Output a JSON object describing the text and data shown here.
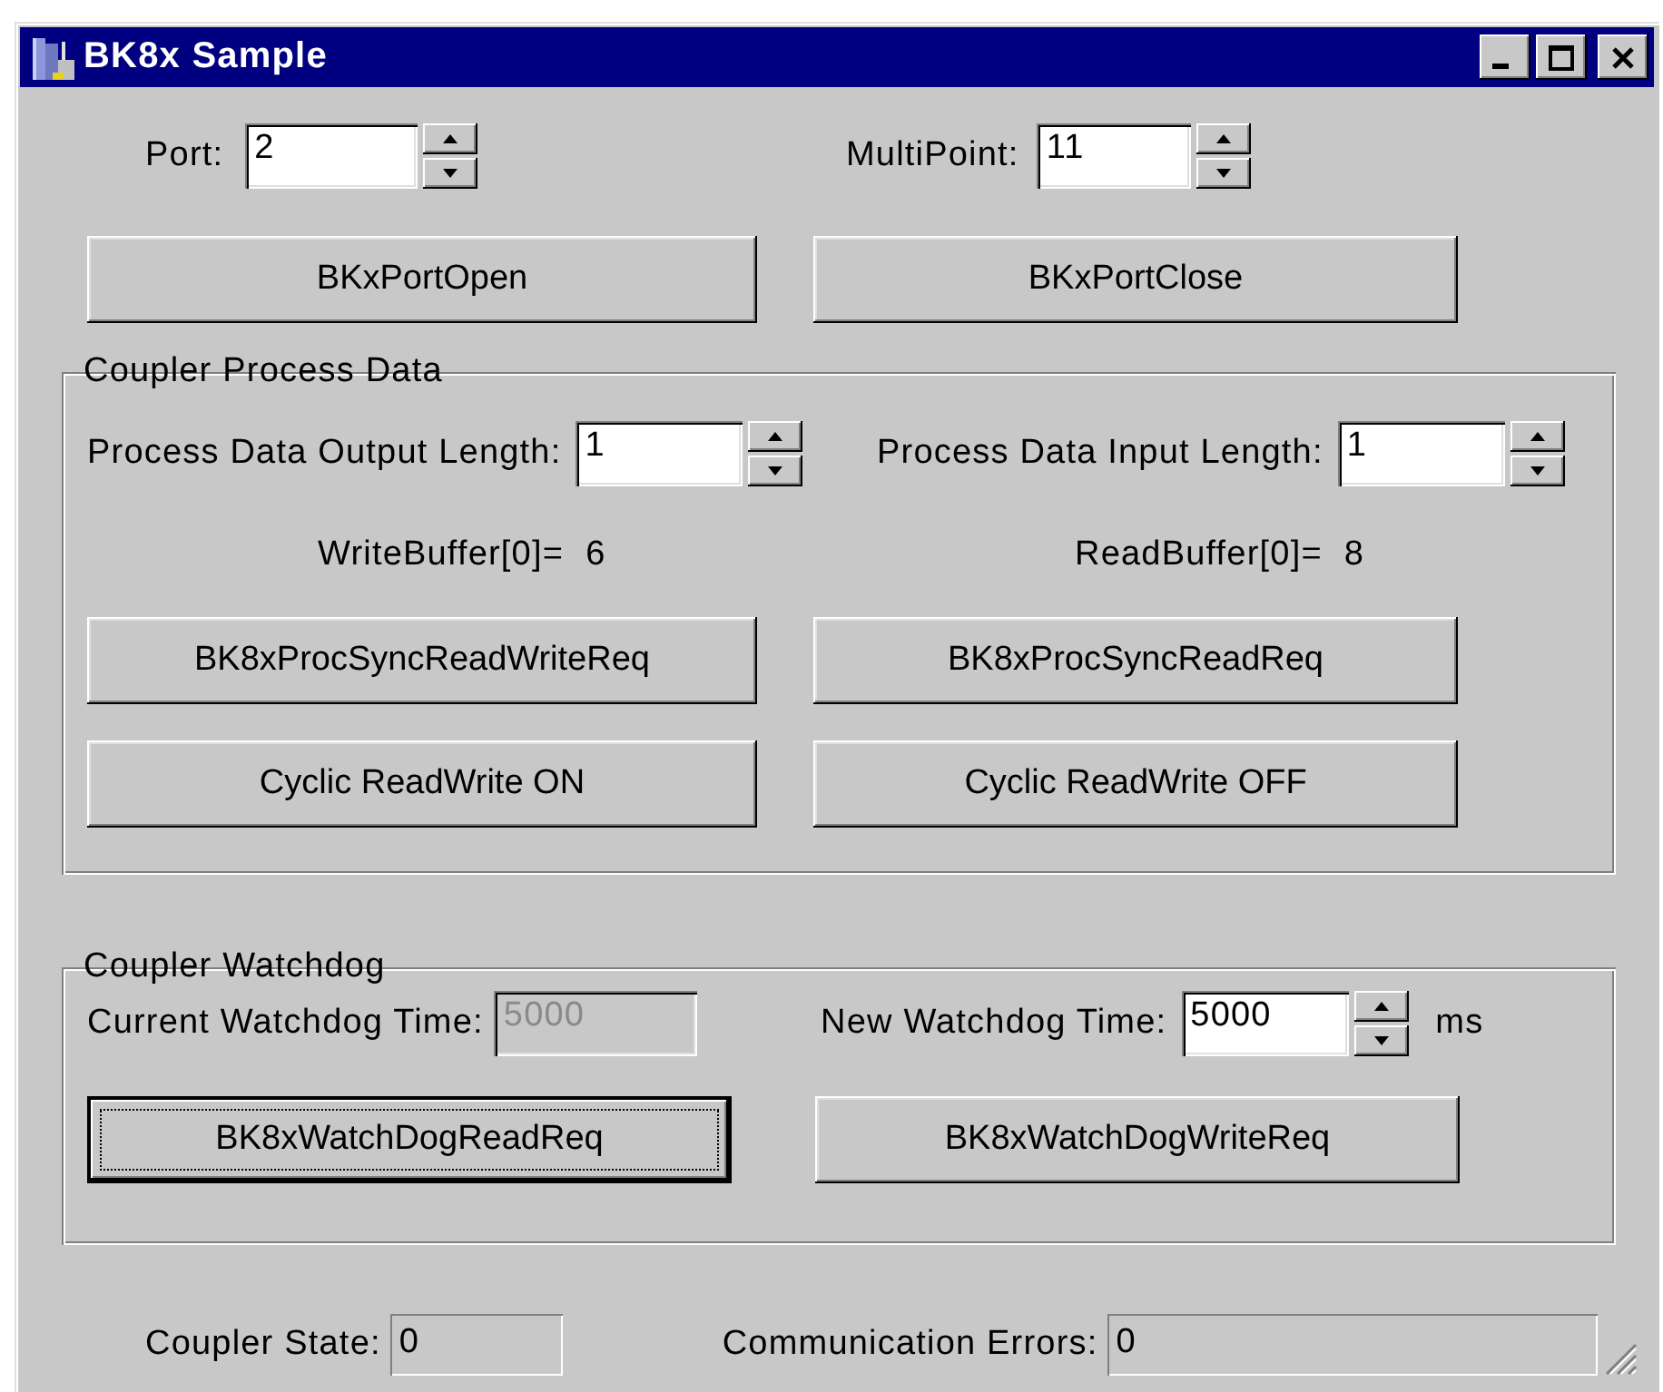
{
  "window": {
    "title": "BK8x Sample"
  },
  "port": {
    "label": "Port:",
    "value": "2"
  },
  "multipoint": {
    "label": "MultiPoint:",
    "value": "11"
  },
  "port_buttons": [
    {
      "label": "BKxPortOpen",
      "default": false
    },
    {
      "label": "BKxPortClose",
      "default": false
    }
  ],
  "process_data": {
    "title": "Coupler Process Data",
    "output_length": {
      "label": "Process Data Output Length:",
      "value": "1"
    },
    "input_length": {
      "label": "Process Data Input Length:",
      "value": "1"
    },
    "write_buffer": {
      "label": "WriteBuffer[0]=",
      "value": "6"
    },
    "read_buffer": {
      "label": "ReadBuffer[0]=",
      "value": "8"
    },
    "buttons": [
      {
        "label": "BK8xProcSyncReadWriteReq",
        "default": false
      },
      {
        "label": "BK8xProcSyncReadReq",
        "default": false
      },
      {
        "label": "Cyclic ReadWrite ON",
        "default": false
      },
      {
        "label": "Cyclic ReadWrite OFF",
        "default": false
      }
    ]
  },
  "watchdog": {
    "title": "Coupler Watchdog",
    "current": {
      "label": "Current Watchdog Time:",
      "value": "5000",
      "disabled": true
    },
    "new": {
      "label": "New Watchdog Time:",
      "value": "5000",
      "unit": "ms"
    },
    "buttons": [
      {
        "label": "BK8xWatchDogReadReq",
        "default": true
      },
      {
        "label": "BK8xWatchDogWriteReq",
        "default": false
      }
    ]
  },
  "status": {
    "coupler_state": {
      "label": "Coupler State:",
      "value": "0"
    },
    "communication_errors": {
      "label": "Communication Errors:",
      "value": "0"
    }
  }
}
